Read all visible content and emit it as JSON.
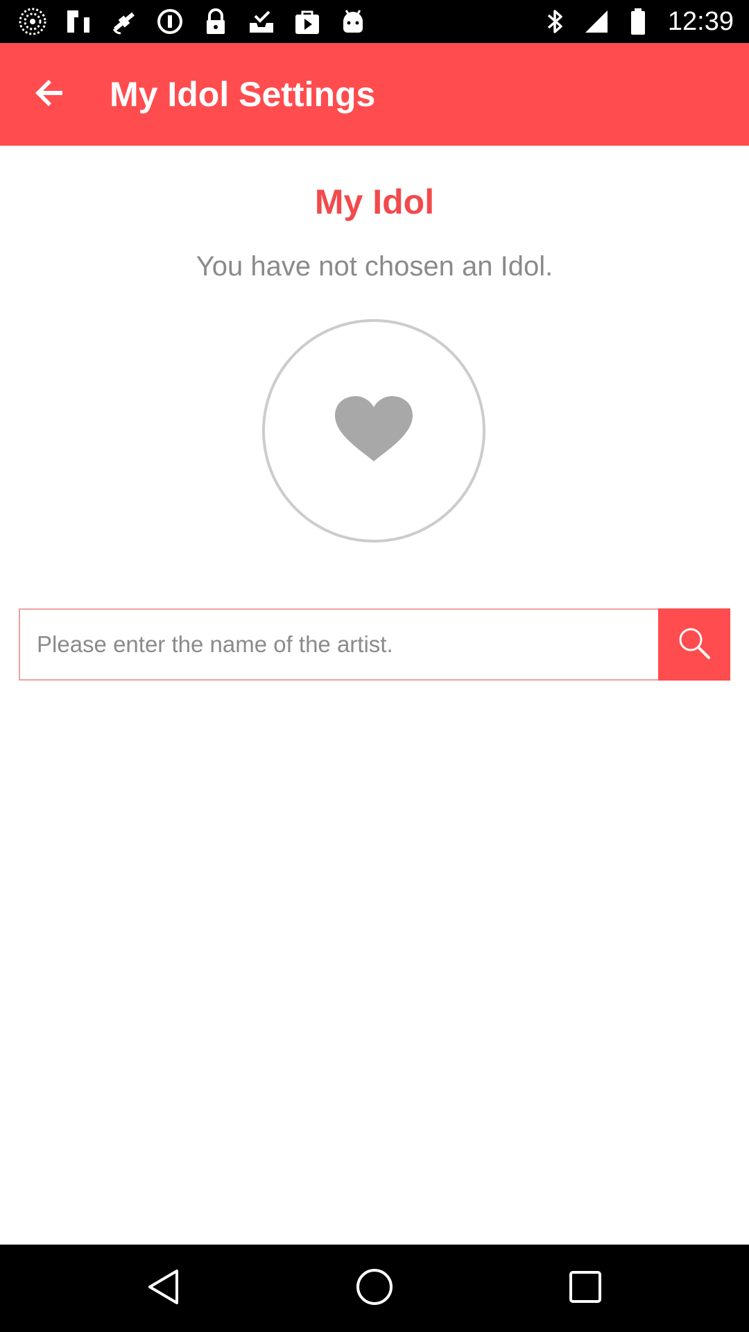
{
  "status_bar": {
    "time": "12:39",
    "left_icons": [
      "radar-icon",
      "fake-gps-icon",
      "satellite-icon",
      "info-circle-icon",
      "lock-icon",
      "check-inbox-icon",
      "play-bag-icon",
      "android-robot-icon"
    ],
    "right_icons": [
      "bluetooth-icon",
      "signal-icon",
      "battery-icon"
    ]
  },
  "app_bar": {
    "title": "My Idol Settings",
    "back_icon": "arrow-back-icon",
    "background": "#ff4c4e"
  },
  "content": {
    "section_title": "My Idol",
    "status_message": "You have not chosen an Idol.",
    "avatar_icon": "heart-icon"
  },
  "search": {
    "placeholder": "Please enter the name of the artist.",
    "value": "",
    "button_icon": "search-icon"
  },
  "nav_bar": {
    "icons": [
      "back-triangle-icon",
      "home-circle-icon",
      "recents-square-icon"
    ]
  },
  "colors": {
    "accent": "#ff4c4e",
    "title_text": "#f24a4c",
    "muted_text": "#8a8a8a",
    "avatar_border": "#cccccc",
    "heart": "#a8a8a8"
  }
}
